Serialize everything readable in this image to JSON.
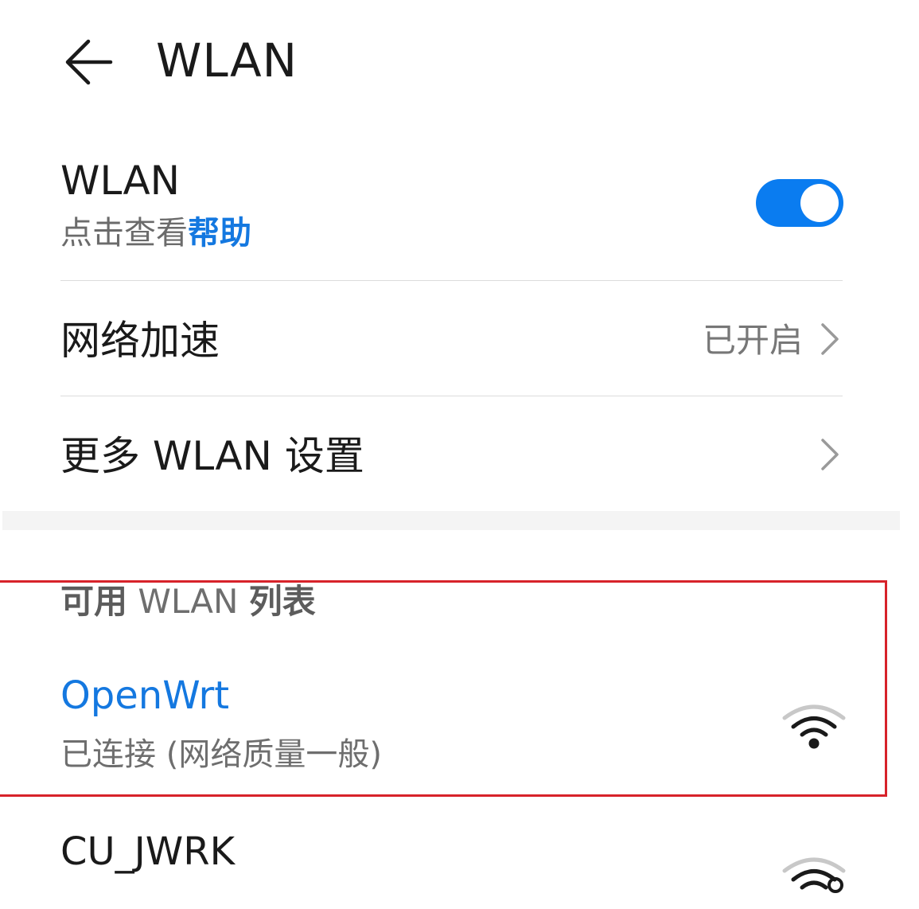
{
  "header": {
    "title": "WLAN"
  },
  "wlan_toggle": {
    "label": "WLAN",
    "help_prefix": "点击查看",
    "help_link": "帮助",
    "enabled": true,
    "accent_color": "#0a7cf0"
  },
  "settings": {
    "acceleration": {
      "label": "网络加速",
      "value": "已开启"
    },
    "more": {
      "label": "更多 WLAN 设置"
    }
  },
  "available_list": {
    "title_cjk_1": "可用",
    "title_latin": "WLAN",
    "title_cjk_2": "列表",
    "networks": [
      {
        "ssid": "OpenWrt",
        "status": "已连接 (网络质量一般)",
        "connected": true,
        "name_color": "#1478e0",
        "icon": "wifi-signal-icon"
      },
      {
        "ssid": "CU_JWRK",
        "status": "",
        "connected": false,
        "name_color": "#1a1a1a",
        "icon": "wifi-locked-icon"
      }
    ]
  },
  "annotation": {
    "highlight_color": "#d7222a"
  }
}
